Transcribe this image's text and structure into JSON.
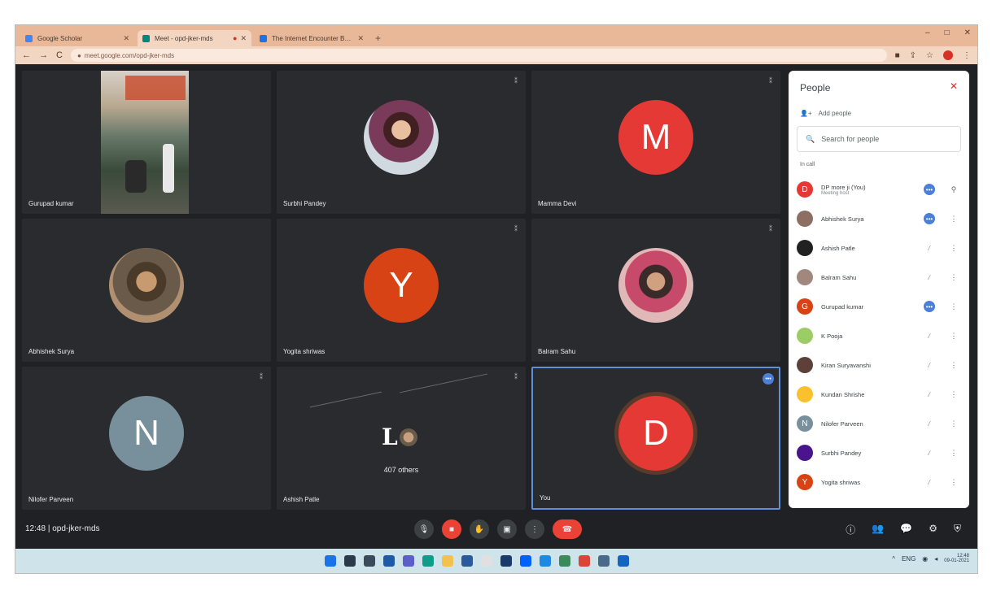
{
  "browser": {
    "tabs": [
      {
        "label": "Google Scholar",
        "color": "#4285f4",
        "active": false
      },
      {
        "label": "Meet - opd-jker-mds",
        "color": "#00897b",
        "active": true
      },
      {
        "label": "The Internet Encounter Book",
        "color": "#1a73e8",
        "active": false
      }
    ],
    "new_tab": "+",
    "url": "meet.google.com/opd-jker-mds",
    "window_controls": [
      "–",
      "□",
      "✕"
    ]
  },
  "tiles": [
    {
      "name": "Gurupad kumar",
      "kind": "video"
    },
    {
      "name": "Surbhi Pandey",
      "kind": "photo"
    },
    {
      "name": "Mamma Devi",
      "kind": "letter",
      "letter": "M",
      "color": "#e53935"
    },
    {
      "name": "Abhishek Surya",
      "kind": "photo"
    },
    {
      "name": "Yogita shriwas",
      "kind": "letter",
      "letter": "Y",
      "color": "#d84315"
    },
    {
      "name": "Balram Sahu",
      "kind": "photo"
    },
    {
      "name": "Nilofer Parveen",
      "kind": "letter",
      "letter": "N",
      "color": "#78909c"
    },
    {
      "name": "Ashish Patle",
      "kind": "others",
      "others_label": "407 others"
    },
    {
      "name": "You",
      "kind": "letter",
      "letter": "D",
      "color": "#e53935"
    }
  ],
  "panel": {
    "title": "People",
    "close": "✕",
    "add_people": "Add people",
    "search_placeholder": "Search for people",
    "section": "In call",
    "participants": [
      {
        "name": "DP more ji (You)",
        "sub": "Meeting host",
        "letter": "D",
        "color": "#e53935",
        "mic": "active",
        "action": "pin"
      },
      {
        "name": "Abhishek Surya",
        "sub": "",
        "letter": "",
        "color": "#8d6e63",
        "mic": "active",
        "action": "more"
      },
      {
        "name": "Ashish Patle",
        "sub": "",
        "letter": "",
        "color": "#212121",
        "mic": "muted",
        "action": "more"
      },
      {
        "name": "Balram Sahu",
        "sub": "",
        "letter": "",
        "color": "#a1887f",
        "mic": "muted",
        "action": "more"
      },
      {
        "name": "Gurupad kumar",
        "sub": "",
        "letter": "G",
        "color": "#d84315",
        "mic": "active",
        "action": "more"
      },
      {
        "name": "K Pooja",
        "sub": "",
        "letter": "",
        "color": "#9ccc65",
        "mic": "muted",
        "action": "more"
      },
      {
        "name": "Kiran Suryavanshi",
        "sub": "",
        "letter": "",
        "color": "#5d4037",
        "mic": "muted",
        "action": "more"
      },
      {
        "name": "Kundan Shrishe",
        "sub": "",
        "letter": "",
        "color": "#fbc02d",
        "mic": "muted",
        "action": "more"
      },
      {
        "name": "Nilofer Parveen",
        "sub": "",
        "letter": "N",
        "color": "#78909c",
        "mic": "muted",
        "action": "more"
      },
      {
        "name": "Surbhi Pandey",
        "sub": "",
        "letter": "",
        "color": "#4a148c",
        "mic": "muted",
        "action": "more"
      },
      {
        "name": "Yogita shriwas",
        "sub": "",
        "letter": "Y",
        "color": "#d84315",
        "mic": "muted",
        "action": "more"
      }
    ]
  },
  "meeting": {
    "time": "12:48",
    "separator": "|",
    "code": "opd-jker-mds"
  },
  "taskbar": {
    "time": "12:48",
    "date": "09-01-2021",
    "tray_text": "ENG"
  }
}
